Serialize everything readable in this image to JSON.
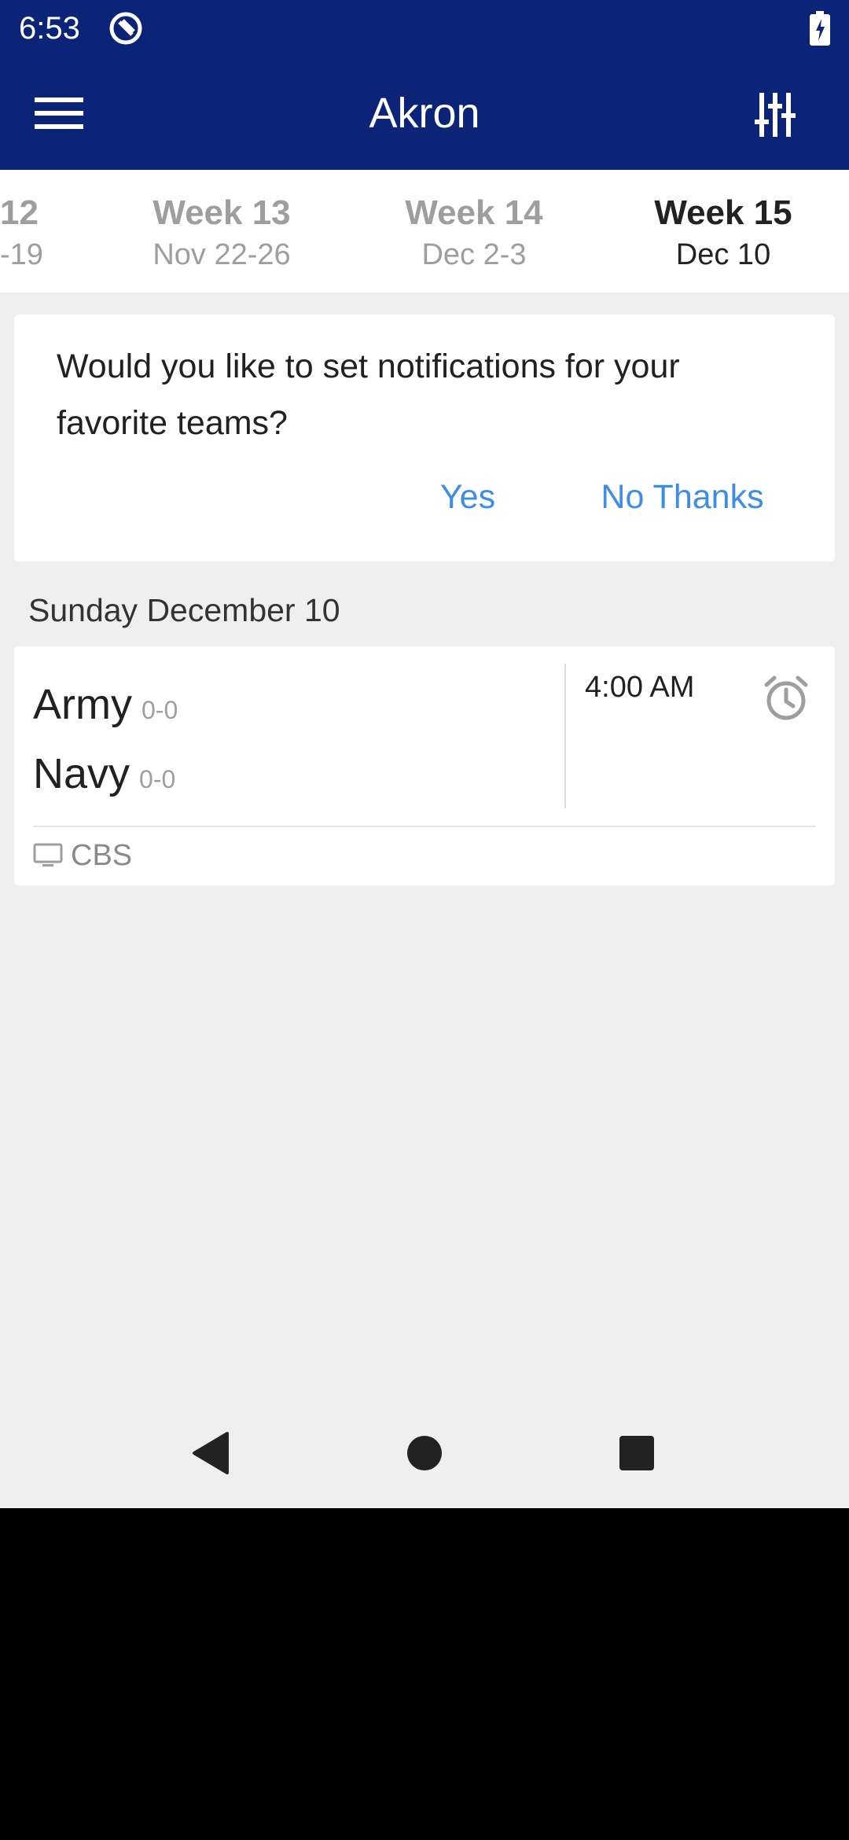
{
  "status_bar": {
    "time": "6:53"
  },
  "app_bar": {
    "title": "Akron"
  },
  "weeks": [
    {
      "week": "12",
      "dates": "-19",
      "active": false
    },
    {
      "week": "Week 13",
      "dates": "Nov 22-26",
      "active": false
    },
    {
      "week": "Week 14",
      "dates": "Dec 2-3",
      "active": false
    },
    {
      "week": "Week 15",
      "dates": "Dec 10",
      "active": true
    }
  ],
  "notification": {
    "message": "Would you like to set notifications for your favorite teams?",
    "yes_label": "Yes",
    "no_label": "No Thanks"
  },
  "day": {
    "header": "Sunday December 10"
  },
  "game": {
    "away_team": "Army",
    "away_record": "0-0",
    "home_team": "Navy",
    "home_record": "0-0",
    "time": "4:00 AM",
    "network": "CBS"
  },
  "colors": {
    "brand_navy": "#0b2477",
    "accent_blue": "#3d8ce6",
    "background": "#efefef"
  },
  "icons": [
    "menu-icon",
    "filter-sliders-icon",
    "alarm-icon",
    "tv-icon",
    "battery-charging-icon",
    "back-icon",
    "home-icon",
    "recents-icon"
  ]
}
